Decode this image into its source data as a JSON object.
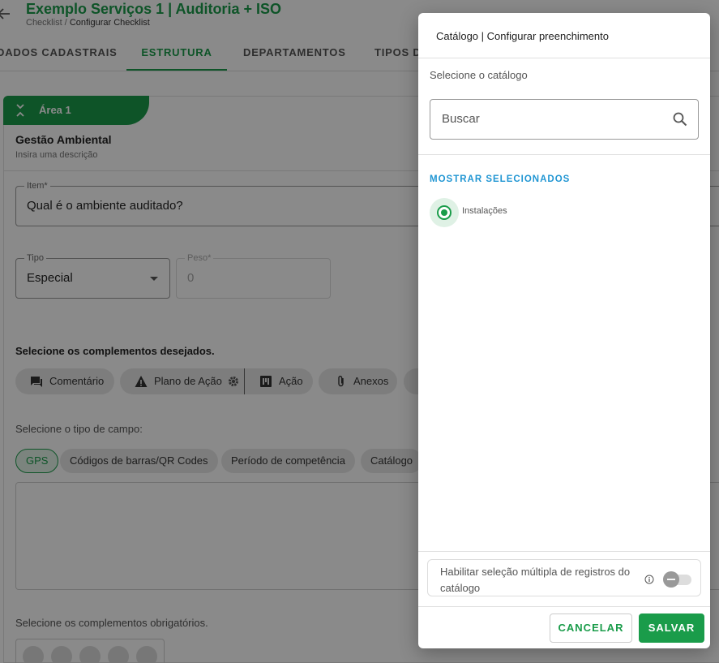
{
  "header": {
    "title": "Exemplo Serviços 1 | Auditoria + ISO",
    "breadcrumb_root": "Checklist /",
    "breadcrumb_current": "Configurar Checklist"
  },
  "tabs": [
    "DADOS CADASTRAIS",
    "ESTRUTURA",
    "DEPARTAMENTOS",
    "TIPOS D"
  ],
  "area": {
    "tab_label": "Área 1",
    "name": "Gestão Ambiental",
    "description": "Insira uma descrição"
  },
  "form": {
    "item_label": "Item*",
    "item_value": "Qual é o ambiente auditado?",
    "tipo_label": "Tipo",
    "tipo_value": "Especial",
    "peso_label": "Peso*",
    "peso_value": "0"
  },
  "complements": {
    "heading": "Selecione os complementos desejados.",
    "chips": [
      {
        "label": "Comentário",
        "icon": "comment-icon"
      },
      {
        "label": "Plano de Ação",
        "icon": "warning-icon"
      },
      {
        "label": "Ação",
        "icon": "action-icon"
      },
      {
        "label": "Anexos",
        "icon": "paperclip-icon"
      }
    ]
  },
  "field_types": {
    "heading": "Selecione o tipo de campo:",
    "chips": [
      "GPS",
      "Códigos de barras/QR Codes",
      "Período de competência",
      "Catálogo"
    ],
    "selected": "GPS"
  },
  "mandatory": {
    "heading": "Selecione os complementos obrigatórios."
  },
  "dialog": {
    "title": "Catálogo | Configurar preenchimento",
    "subtitle": "Selecione o catálogo",
    "search_placeholder": "Buscar",
    "show_selected": "MOSTRAR SELECIONADOS",
    "option_label": "Instalações",
    "multi_select_label": "Habilitar seleção múltipla de registros do catálogo",
    "multi_select_enabled": false,
    "cancel_label": "CANCELAR",
    "save_label": "SALVAR"
  },
  "colors": {
    "primary": "#1a9c4a",
    "link": "#2196d3"
  }
}
